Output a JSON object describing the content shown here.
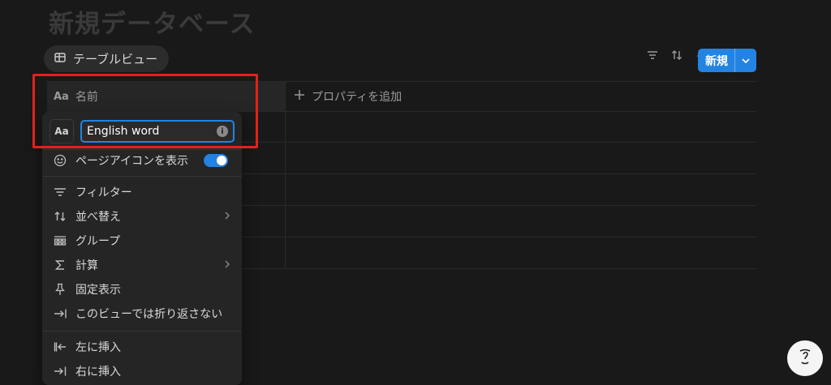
{
  "page": {
    "title": "新規データベース"
  },
  "view_tab": {
    "label": "テーブルビュー",
    "icon": "table-icon"
  },
  "toolbar": {
    "icons": [
      "filter-icon",
      "sort-icon",
      "lightning-icon",
      "search-icon",
      "settings-icon"
    ],
    "new_label": "新規"
  },
  "table": {
    "column_name": "名前",
    "add_property": "プロパティを追加",
    "rows": 5
  },
  "menu": {
    "name_value": "English word",
    "aa_label": "Aa",
    "items": [
      {
        "label": "ページアイコンを表示",
        "icon": "smile-icon",
        "toggle": true
      },
      {
        "label": "フィルター",
        "icon": "filter-icon"
      },
      {
        "label": "並べ替え",
        "icon": "sort-icon",
        "chevron": true
      },
      {
        "label": "グループ",
        "icon": "group-icon"
      },
      {
        "label": "計算",
        "icon": "sigma-icon",
        "chevron": true
      },
      {
        "label": "固定表示",
        "icon": "pin-icon"
      },
      {
        "label": "このビューでは折り返さない",
        "icon": "no-wrap-icon"
      },
      {
        "label": "左に挿入",
        "icon": "insert-left-icon"
      },
      {
        "label": "右に挿入",
        "icon": "insert-right-icon"
      }
    ]
  },
  "colors": {
    "accent": "#2383e2",
    "highlight": "#e0221d",
    "background": "#191919"
  }
}
